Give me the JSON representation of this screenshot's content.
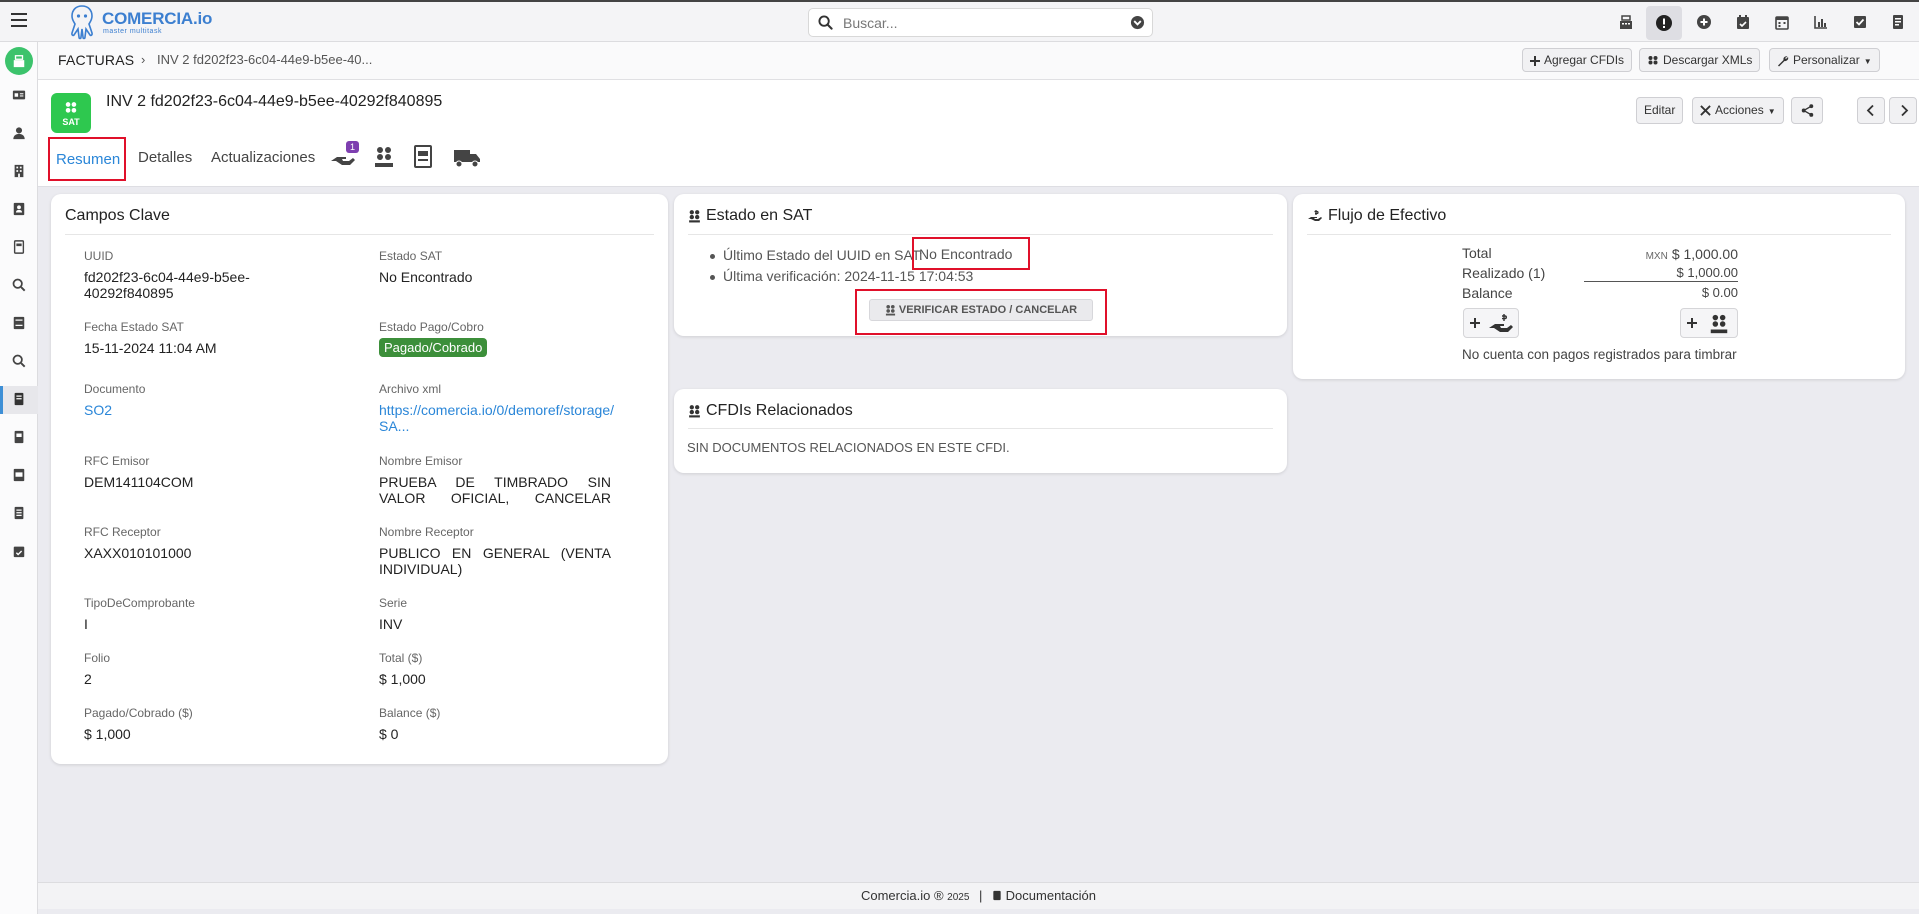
{
  "app": {
    "brand_name": "COMERCIA.io",
    "brand_tagline": "master multitask"
  },
  "search": {
    "placeholder": "Buscar..."
  },
  "top_icons": [
    "cash-register-icon",
    "alert-icon",
    "plus-circle-icon",
    "calendar-check-icon",
    "calendar-icon",
    "bar-chart-icon",
    "checkbox-icon"
  ],
  "sidebar": {
    "items": [
      "contact-card-icon",
      "user-icon",
      "building-icon",
      "address-book-icon",
      "book-icon",
      "search-icon",
      "ov-document-icon",
      "search-icon",
      "invoice-book-icon",
      "book-icon",
      "nc-document-icon",
      "book-icon",
      "calendar-check-icon"
    ]
  },
  "breadcrumb": {
    "section": "FACTURAS",
    "separator": "›",
    "current": "INV 2 fd202f23-6c04-44e9-b5ee-40..."
  },
  "crumb_actions": {
    "add_cfdis": "Agregar CFDIs",
    "download_xml": "Descargar XMLs",
    "customize": "Personalizar"
  },
  "record": {
    "logo_text": "SAT",
    "title": "INV 2 fd202f23-6c04-44e9-b5ee-40292f840895"
  },
  "record_actions": {
    "edit": "Editar",
    "actions": "Acciones"
  },
  "tabs": {
    "summary": "Resumen",
    "details": "Detalles",
    "updates": "Actualizaciones",
    "payments_badge": "1"
  },
  "key_fields": {
    "title": "Campos Clave",
    "uuid": {
      "label": "UUID",
      "value": "fd202f23-6c04-44e9-b5ee-40292f840895"
    },
    "sat_status": {
      "label": "Estado SAT",
      "value": "No Encontrado"
    },
    "sat_status_date": {
      "label": "Fecha Estado SAT",
      "value": "15-11-2024 11:04 AM"
    },
    "payment_status": {
      "label": "Estado Pago/Cobro",
      "value": "Pagado/Cobrado"
    },
    "document": {
      "label": "Documento",
      "value": "SO2"
    },
    "xml_file": {
      "label": "Archivo xml",
      "value": "https://comercia.io/0/demoref/storage/SA..."
    },
    "rfc_issuer": {
      "label": "RFC Emisor",
      "value": "DEM141104COM"
    },
    "issuer_name": {
      "label": "Nombre Emisor",
      "value": "PRUEBA DE TIMBRADO SIN VALOR OFICIAL, CANCELAR"
    },
    "rfc_receiver": {
      "label": "RFC Receptor",
      "value": "XAXX010101000"
    },
    "receiver_name": {
      "label": "Nombre Receptor",
      "value": "PUBLICO EN GENERAL (VENTA INDIVIDUAL)"
    },
    "voucher_type": {
      "label": "TipoDeComprobante",
      "value": "I"
    },
    "series": {
      "label": "Serie",
      "value": "INV"
    },
    "folio": {
      "label": "Folio",
      "value": "2"
    },
    "total": {
      "label": "Total ($)",
      "value": "$ 1,000"
    },
    "paid": {
      "label": "Pagado/Cobrado ($)",
      "value": "$ 1,000"
    },
    "balance": {
      "label": "Balance ($)",
      "value": "$ 0"
    }
  },
  "sat_card": {
    "title": "Estado en SAT",
    "last_status_label": "Último Estado del UUID en SAT:",
    "last_status_value": "No Encontrado",
    "last_check": "Última verificación: 2024-11-15 17:04:53",
    "verify_button": "VERIFICAR ESTADO / CANCELAR"
  },
  "related": {
    "title": "CFDIs Relacionados",
    "empty": "SIN DOCUMENTOS RELACIONADOS EN ESTE CFDI."
  },
  "cash_flow": {
    "title": "Flujo de Efectivo",
    "total_label": "Total",
    "currency": "MXN",
    "total_value": "$ 1,000.00",
    "realized_label": "Realizado (1)",
    "realized_value": "$ 1,000.00",
    "balance_label": "Balance",
    "balance_value": "$ 0.00",
    "empty_note": "No cuenta con pagos registrados para timbrar"
  },
  "footer": {
    "brand": "Comercia.io ®",
    "year": "2025",
    "separator": "|",
    "docs": "Documentación"
  },
  "colors": {
    "accent": "#2a86d8",
    "highlight": "#e0102a",
    "sat_green": "#2ec84f",
    "paid_green": "#3c8f3a",
    "badge_purple": "#7e3fb0"
  }
}
